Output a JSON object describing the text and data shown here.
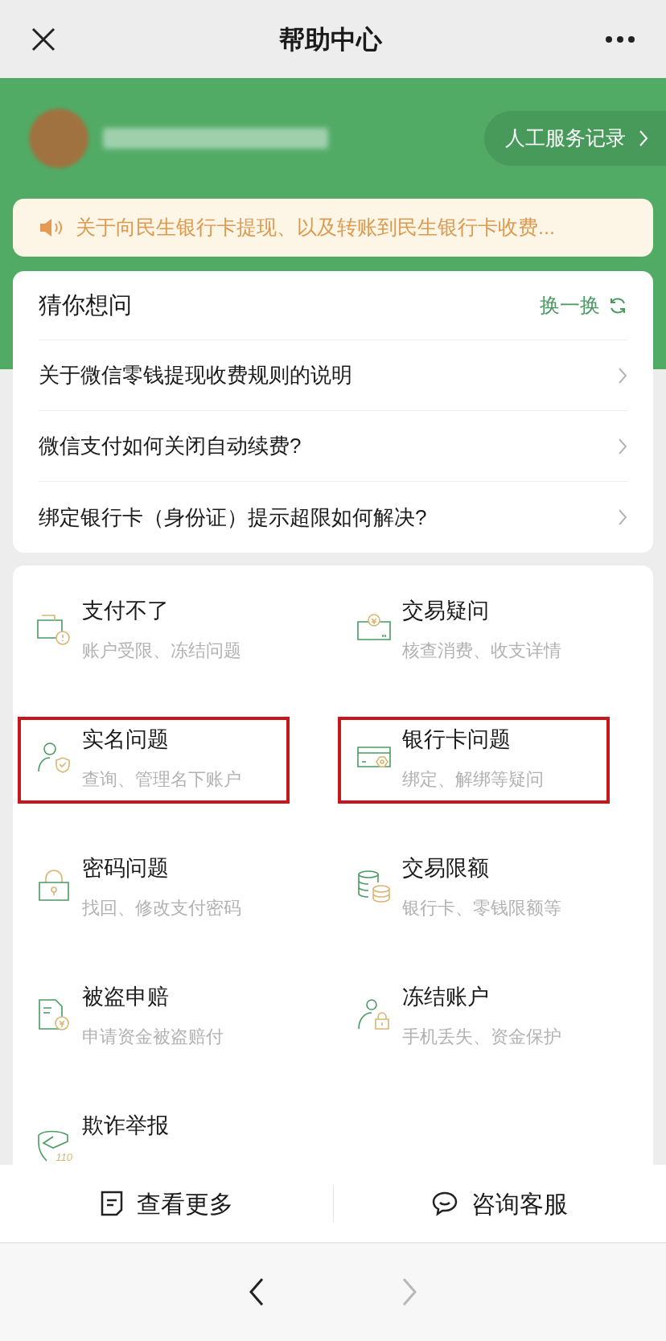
{
  "header": {
    "title": "帮助中心"
  },
  "profile": {
    "service_record": "人工服务记录"
  },
  "notice": {
    "text": "关于向民生银行卡提现、以及转账到民生银行卡收费..."
  },
  "guess": {
    "title": "猜你想问",
    "refresh": "换一换",
    "questions": [
      "关于微信零钱提现收费规则的说明",
      "微信支付如何关闭自动续费?",
      "绑定银行卡（身份证）提示超限如何解决?"
    ]
  },
  "categories": [
    {
      "kind": "wallet",
      "title": "支付不了",
      "subtitle": "账户受限、冻结问题",
      "highlighted": false
    },
    {
      "kind": "coin",
      "title": "交易疑问",
      "subtitle": "核查消费、收支详情",
      "highlighted": false
    },
    {
      "kind": "person-shield",
      "title": "实名问题",
      "subtitle": "查询、管理名下账户",
      "highlighted": true
    },
    {
      "kind": "card",
      "title": "银行卡问题",
      "subtitle": "绑定、解绑等疑问",
      "highlighted": true
    },
    {
      "kind": "lock",
      "title": "密码问题",
      "subtitle": "找回、修改支付密码",
      "highlighted": false
    },
    {
      "kind": "coins",
      "title": "交易限额",
      "subtitle": "银行卡、零钱限额等",
      "highlighted": false
    },
    {
      "kind": "document",
      "title": "被盗申赔",
      "subtitle": "申请资金被盗赔付",
      "highlighted": false
    },
    {
      "kind": "person-lock",
      "title": "冻结账户",
      "subtitle": "手机丢失、资金保护",
      "highlighted": false
    },
    {
      "kind": "police",
      "title": "欺诈举报",
      "icon_text": "110",
      "highlighted": false
    }
  ],
  "bottom_actions": [
    "查看更多",
    "咨询客服"
  ],
  "nav": {
    "back_disabled": false,
    "forward_disabled": true
  }
}
